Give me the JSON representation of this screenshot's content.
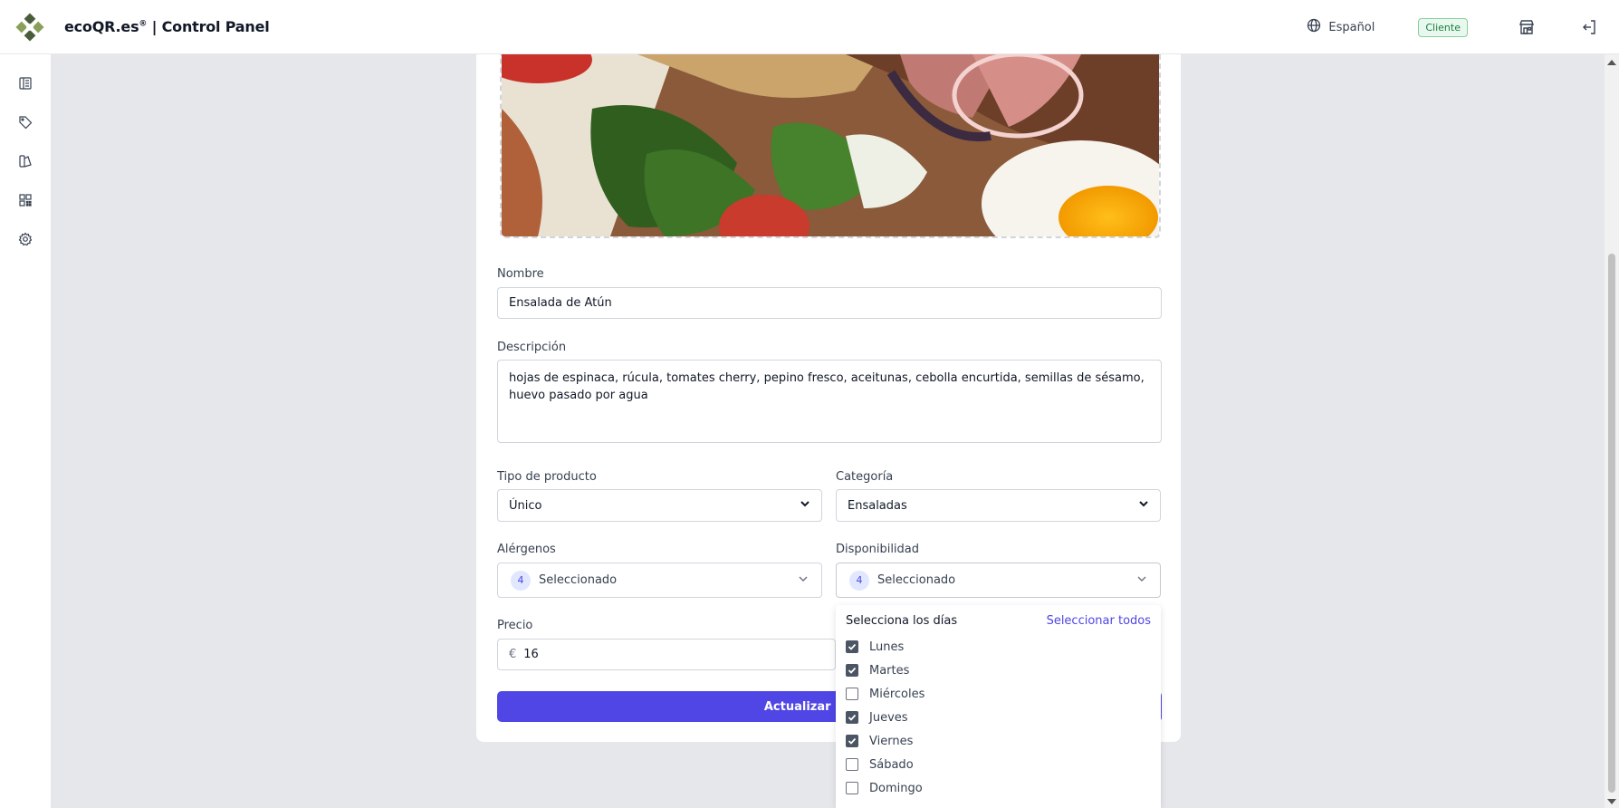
{
  "header": {
    "brand": "ecoQR.es",
    "brand_mark": "®",
    "title": " | Control Panel",
    "language": "Español",
    "role_badge": "Cliente"
  },
  "sidebar": {
    "items": [
      {
        "icon": "menu-book-icon"
      },
      {
        "icon": "tag-icon"
      },
      {
        "icon": "design-icon"
      },
      {
        "icon": "qr-code-icon"
      },
      {
        "icon": "gear-icon"
      }
    ]
  },
  "form": {
    "name_label": "Nombre",
    "name_value": "Ensalada de Atún",
    "description_label": "Descripción",
    "description_value": "hojas de espinaca, rúcula, tomates cherry, pepino fresco, aceitunas, cebolla encurtida, semillas de sésamo, huevo pasado por agua",
    "type_label": "Tipo de producto",
    "type_value": "Único",
    "category_label": "Categoría",
    "category_value": "Ensaladas",
    "allergens_label": "Alérgenos",
    "allergens_count": "4",
    "allergens_value": "Seleccionado",
    "availability_label": "Disponibilidad",
    "availability_count": "4",
    "availability_value": "Seleccionado",
    "price_label": "Precio",
    "price_currency": "€",
    "price_value": "16",
    "submit_label": "Actualizar producto"
  },
  "days_dropdown": {
    "title": "Selecciona los días",
    "select_all": "Seleccionar todos",
    "days": [
      {
        "label": "Lunes",
        "checked": true
      },
      {
        "label": "Martes",
        "checked": true
      },
      {
        "label": "Miércoles",
        "checked": false
      },
      {
        "label": "Jueves",
        "checked": true
      },
      {
        "label": "Viernes",
        "checked": true
      },
      {
        "label": "Sábado",
        "checked": false
      },
      {
        "label": "Domingo",
        "checked": false
      }
    ]
  },
  "colors": {
    "accent": "#4f46e5",
    "brand_green": "#4a5d3a",
    "badge_green": "#15803d"
  }
}
